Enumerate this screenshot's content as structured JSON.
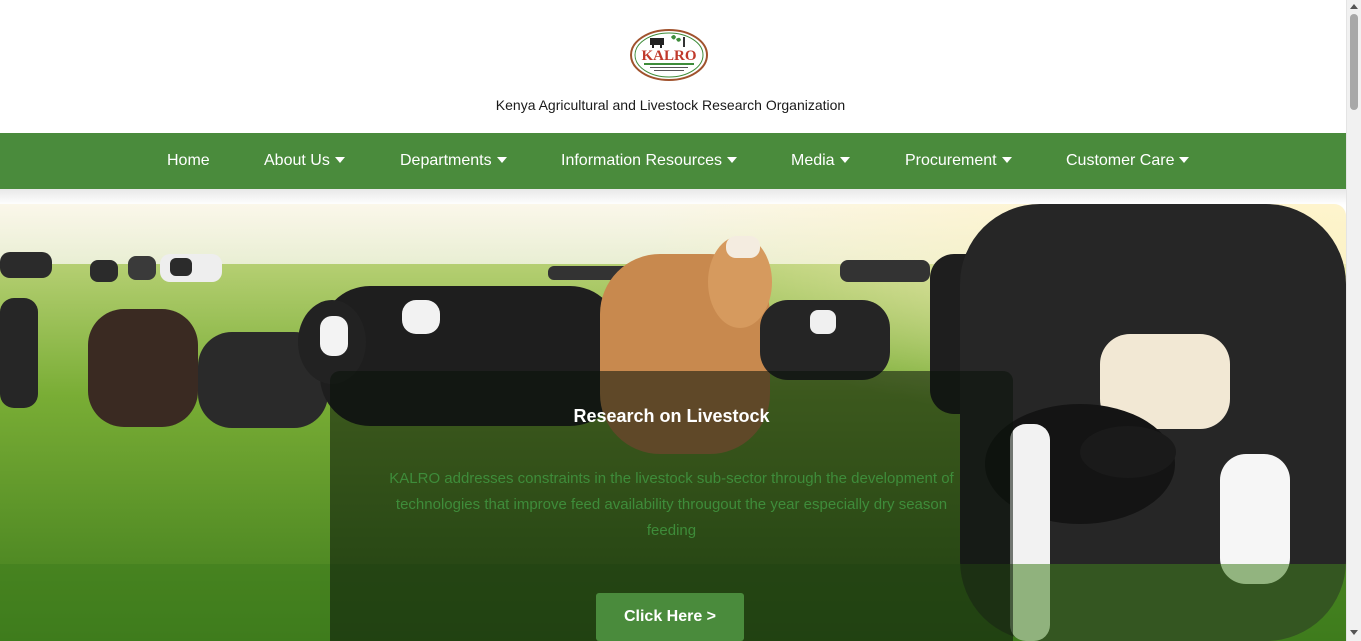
{
  "header": {
    "logo_text": "KALRO",
    "logo_subtext": "Kenya Agricultural & Livestock Research Organization",
    "org_name": "Kenya Agricultural and Livestock Research Organization"
  },
  "nav": {
    "items": [
      {
        "label": "Home",
        "has_dropdown": false
      },
      {
        "label": "About Us",
        "has_dropdown": true
      },
      {
        "label": "Departments",
        "has_dropdown": true
      },
      {
        "label": "Information Resources",
        "has_dropdown": true
      },
      {
        "label": "Media",
        "has_dropdown": true
      },
      {
        "label": "Procurement",
        "has_dropdown": true
      },
      {
        "label": "Customer Care",
        "has_dropdown": true
      }
    ]
  },
  "hero": {
    "image_subject": "dairy cows grazing on a green pasture at sunrise",
    "title": "Research on Livestock",
    "description": "KALRO addresses constraints in the livestock sub-sector through the development of technologies that improve feed availability througout the year especially dry season feeding",
    "button_label": "Click Here >"
  },
  "colors": {
    "brand_green": "#4a8b3c",
    "description_text": "#3e8c3a",
    "logo_red": "#c0392b"
  }
}
